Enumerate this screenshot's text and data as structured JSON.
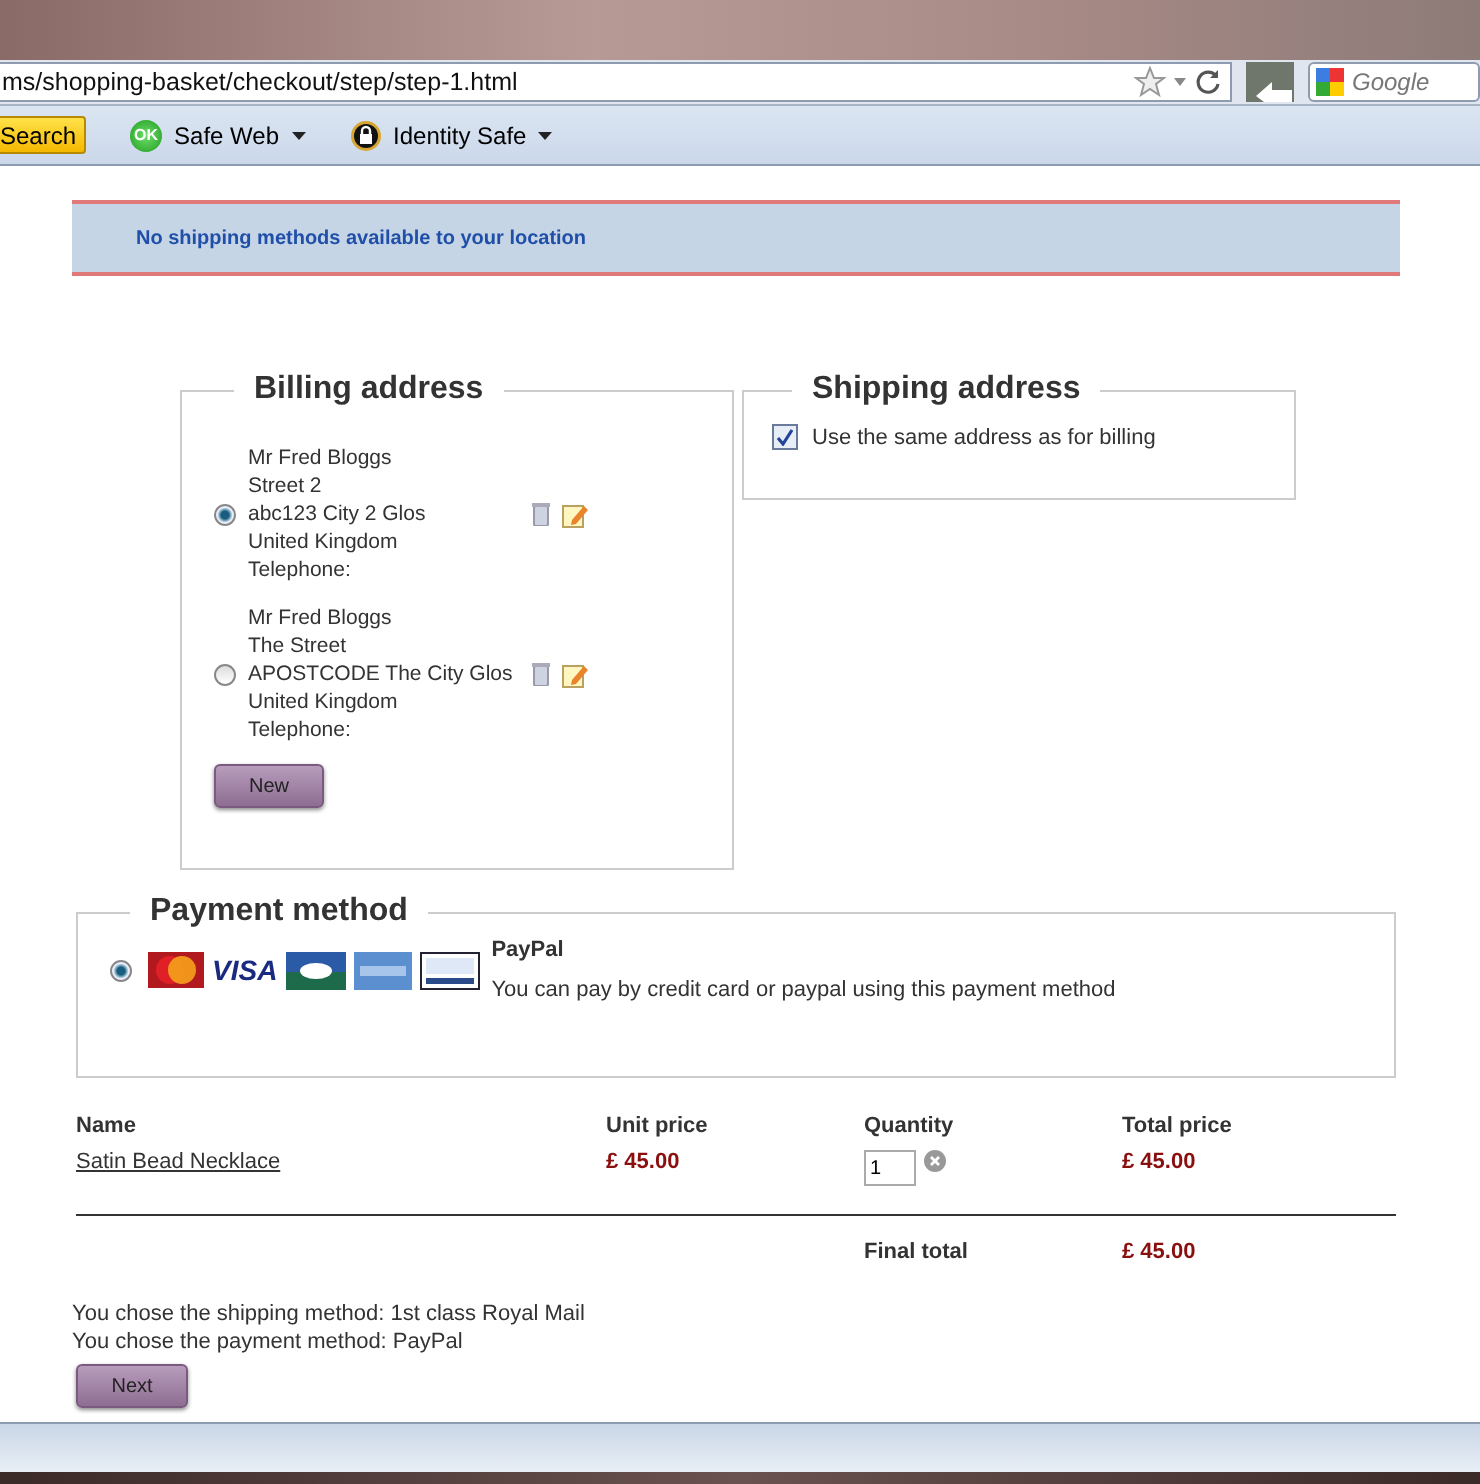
{
  "browser": {
    "url": "ms/shopping-basket/checkout/step/step-1.html",
    "search_placeholder": "Google",
    "toolbar": [
      {
        "kind": "search",
        "label": "Search"
      },
      {
        "kind": "safeweb",
        "label": "Safe Web",
        "badge": "OK"
      },
      {
        "kind": "identity",
        "label": "Identity Safe"
      }
    ]
  },
  "notice": "No shipping methods available to your location",
  "billing": {
    "title": "Billing address",
    "addresses": [
      {
        "selected": true,
        "lines": [
          "Mr Fred Bloggs",
          "Street 2",
          "abc123 City 2 Glos",
          "United Kingdom",
          "Telephone:"
        ]
      },
      {
        "selected": false,
        "lines": [
          "Mr Fred Bloggs",
          "The Street",
          "APOSTCODE The City Glos",
          "United Kingdom",
          "Telephone:"
        ]
      }
    ],
    "new_button": "New"
  },
  "shipping": {
    "title": "Shipping address",
    "same_as_billing": {
      "label": "Use the same address as for billing",
      "checked": true
    }
  },
  "payment": {
    "title": "Payment method",
    "methods": [
      {
        "selected": true,
        "name": "PayPal",
        "description": "You can pay by credit card or paypal using this payment method",
        "logos": [
          {
            "kind": "mastercard"
          },
          {
            "kind": "visa",
            "text": "VISA"
          },
          {
            "kind": "cb"
          },
          {
            "kind": "amex"
          },
          {
            "kind": "paypal"
          }
        ]
      }
    ]
  },
  "basket": {
    "columns": [
      "Name",
      "Unit price",
      "Quantity",
      "Total price"
    ],
    "rows": [
      {
        "name": "Satin Bead Necklace",
        "unit_price": "£ 45.00",
        "quantity": "1",
        "total_price": "£ 45.00"
      }
    ],
    "final_label": "Final total",
    "final_total": "£ 45.00"
  },
  "summary": [
    "You chose the shipping method: 1st class Royal Mail",
    "You chose the payment method: PayPal"
  ],
  "next_button": "Next"
}
